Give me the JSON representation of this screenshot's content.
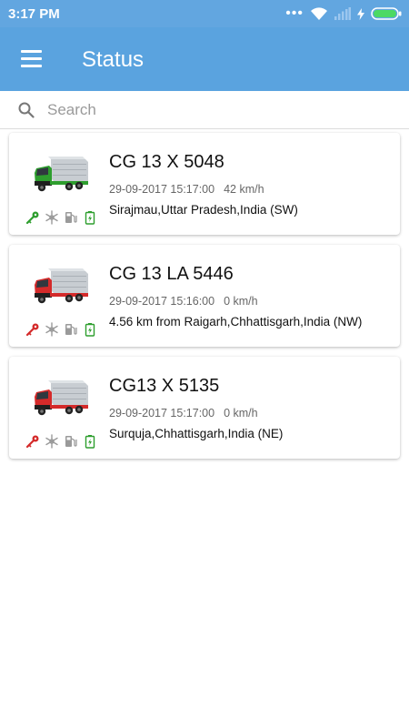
{
  "status_bar": {
    "time": "3:17 PM"
  },
  "app_bar": {
    "title": "Status"
  },
  "search": {
    "placeholder": "Search"
  },
  "vehicles": [
    {
      "number": "CG 13 X 5048",
      "datetime": "29-09-2017 15:17:00",
      "speed": "42 km/h",
      "location": "Sirajmau,Uttar Pradesh,India (SW)",
      "truck_color": "#2e9e2e",
      "ignition_color": "#2e9e2e"
    },
    {
      "number": "CG 13 LA 5446",
      "datetime": "29-09-2017 15:16:00",
      "speed": "0 km/h",
      "location": "4.56 km from Raigarh,Chhattisgarh,India (NW)",
      "truck_color": "#d42a2a",
      "ignition_color": "#d42a2a"
    },
    {
      "number": "CG13 X 5135",
      "datetime": "29-09-2017 15:17:00",
      "speed": "0 km/h",
      "location": "Surquja,Chhattisgarh,India (NE)",
      "truck_color": "#d42a2a",
      "ignition_color": "#d42a2a"
    }
  ],
  "icons": {
    "status_icons": [
      "key-icon",
      "snowflake-icon",
      "fuel-pump-icon",
      "battery-icon"
    ],
    "battery_color": "#2e9e2e",
    "neutral_icon_color": "#9a9a9a"
  }
}
